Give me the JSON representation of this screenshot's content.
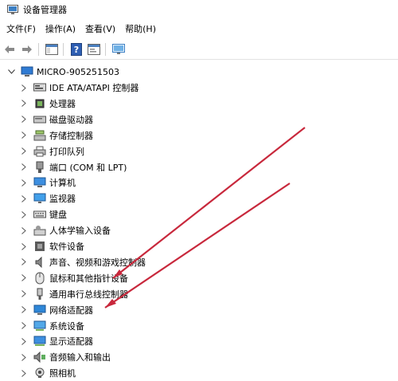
{
  "window": {
    "title": "设备管理器"
  },
  "menu": [
    "文件(F)",
    "操作(A)",
    "查看(V)",
    "帮助(H)"
  ],
  "tree": {
    "root": "MICRO-905251503",
    "categories": [
      {
        "label": "IDE ATA/ATAPI 控制器",
        "icon": "ide-controller-icon"
      },
      {
        "label": "处理器",
        "icon": "processor-icon"
      },
      {
        "label": "磁盘驱动器",
        "icon": "disk-drive-icon"
      },
      {
        "label": "存储控制器",
        "icon": "storage-controller-icon"
      },
      {
        "label": "打印队列",
        "icon": "printer-icon"
      },
      {
        "label": "端口 (COM 和 LPT)",
        "icon": "port-icon"
      },
      {
        "label": "计算机",
        "icon": "computer-icon"
      },
      {
        "label": "监视器",
        "icon": "monitor-icon"
      },
      {
        "label": "键盘",
        "icon": "keyboard-icon"
      },
      {
        "label": "人体学输入设备",
        "icon": "hid-icon"
      },
      {
        "label": "软件设备",
        "icon": "software-device-icon"
      },
      {
        "label": "声音、视频和游戏控制器",
        "icon": "speaker-icon"
      },
      {
        "label": "鼠标和其他指针设备",
        "icon": "mouse-icon"
      },
      {
        "label": "通用串行总线控制器",
        "icon": "usb-icon"
      },
      {
        "label": "网络适配器",
        "icon": "network-adapter-icon"
      },
      {
        "label": "系统设备",
        "icon": "system-device-icon"
      },
      {
        "label": "显示适配器",
        "icon": "display-adapter-icon"
      },
      {
        "label": "音频输入和输出",
        "icon": "audio-io-icon"
      },
      {
        "label": "照相机",
        "icon": "camera-icon"
      }
    ]
  },
  "annotation_color": "#c8283c"
}
